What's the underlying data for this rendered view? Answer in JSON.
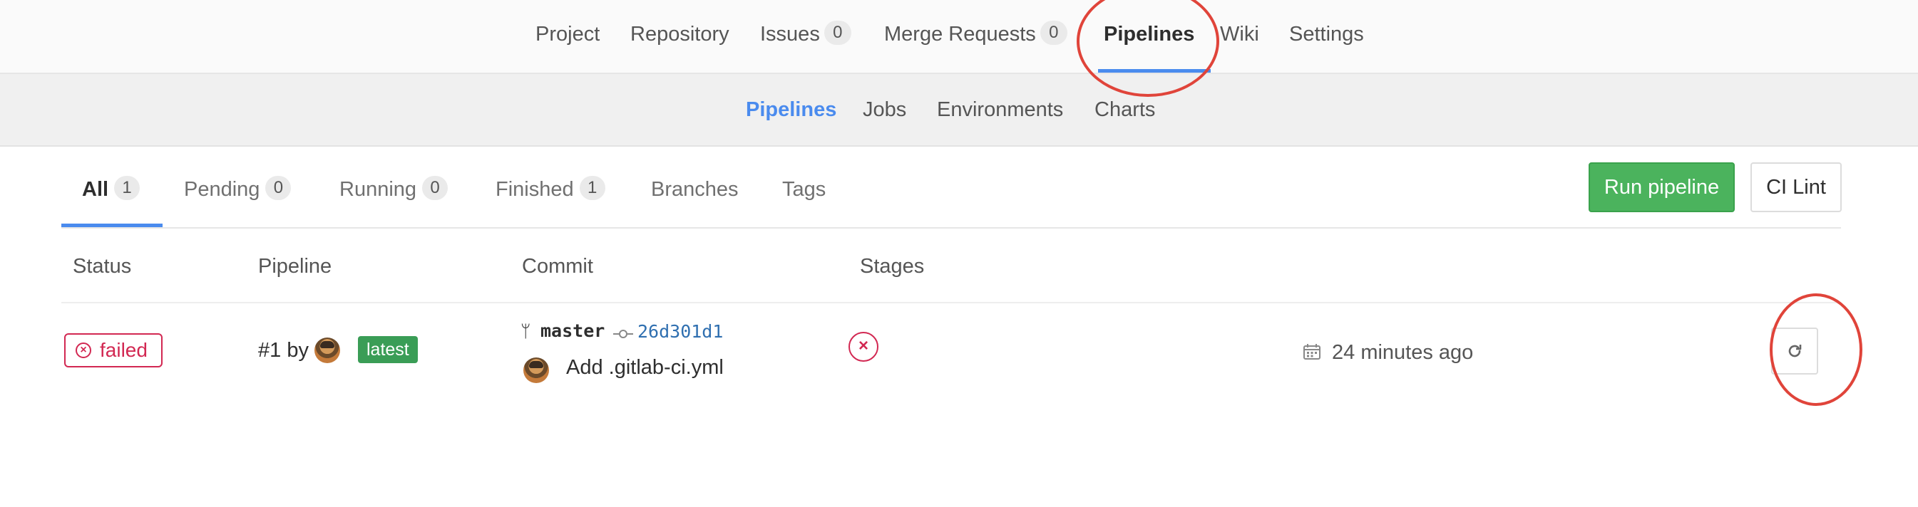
{
  "top_nav": {
    "items": [
      {
        "label": "Project"
      },
      {
        "label": "Repository"
      },
      {
        "label": "Issues",
        "count": "0"
      },
      {
        "label": "Merge Requests",
        "count": "0"
      },
      {
        "label": "Pipelines",
        "active": true
      },
      {
        "label": "Wiki"
      },
      {
        "label": "Settings"
      }
    ]
  },
  "sub_nav": {
    "items": [
      {
        "label": "Pipelines",
        "active": true
      },
      {
        "label": "Jobs"
      },
      {
        "label": "Environments"
      },
      {
        "label": "Charts"
      }
    ]
  },
  "filter_tabs": [
    {
      "label": "All",
      "count": "1",
      "active": true
    },
    {
      "label": "Pending",
      "count": "0"
    },
    {
      "label": "Running",
      "count": "0"
    },
    {
      "label": "Finished",
      "count": "1"
    },
    {
      "label": "Branches"
    },
    {
      "label": "Tags"
    }
  ],
  "actions": {
    "run_pipeline": "Run pipeline",
    "ci_lint": "CI Lint"
  },
  "table": {
    "headers": [
      "Status",
      "Pipeline",
      "Commit",
      "Stages"
    ],
    "rows": [
      {
        "status": "failed",
        "pipeline_id": "#1 by",
        "latest_badge": "latest",
        "branch": "master",
        "commit_sha": "26d301d1",
        "commit_message": "Add .gitlab-ci.yml",
        "stage_status": "failed",
        "time_ago": "24 minutes ago",
        "retry_icon": "retry-icon"
      }
    ]
  },
  "colors": {
    "accent": "#4a8bee",
    "success": "#4bb35d",
    "danger": "#d22852",
    "annotation": "#e0443a"
  }
}
